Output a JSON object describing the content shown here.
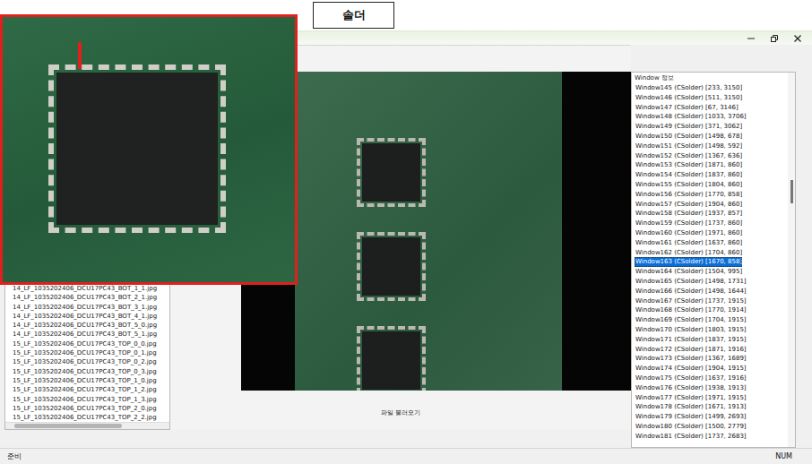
{
  "header_label": "솔더",
  "file_list": {
    "items": [
      "14_LF_1035202406_DCU17PC43_BOT_1_1.jpg",
      "14_LF_1035202406_DCU17PC43_BOT_2_1.jpg",
      "14_LF_1035202406_DCU17PC43_BOT_3_1.jpg",
      "14_LF_1035202406_DCU17PC43_BOT_4_1.jpg",
      "14_LF_1035202406_DCU17PC43_BOT_5_0.jpg",
      "14_LF_1035202406_DCU17PC43_BOT_5_1.jpg",
      "15_LF_1035202406_DCU17PC43_TOP_0_0.jpg",
      "15_LF_1035202406_DCU17PC43_TOP_0_1.jpg",
      "15_LF_1035202406_DCU17PC43_TOP_0_2.jpg",
      "15_LF_1035202406_DCU17PC43_TOP_0_3.jpg",
      "15_LF_1035202406_DCU17PC43_TOP_1_0.jpg",
      "15_LF_1035202406_DCU17PC43_TOP_1_2.jpg",
      "15_LF_1035202406_DCU17PC43_TOP_1_3.jpg",
      "15_LF_1035202406_DCU17PC43_TOP_2_0.jpg",
      "15_LF_1035202406_DCU17PC43_TOP_2_2.jpg"
    ]
  },
  "viewer": {
    "load_button": "파일 불러오기"
  },
  "window_info": {
    "title": "Window 정보",
    "items": [
      {
        "label": "Window145 (CSolder) [233, 3150]",
        "selected": false
      },
      {
        "label": "Window146 (CSolder) [511, 3150]",
        "selected": false
      },
      {
        "label": "Window147 (CSolder) [67, 3146]",
        "selected": false
      },
      {
        "label": "Window148 (CSolder) [1033, 3706]",
        "selected": false
      },
      {
        "label": "Window149 (CSolder) [371, 3062]",
        "selected": false
      },
      {
        "label": "Window150 (CSolder) [1498, 678]",
        "selected": false
      },
      {
        "label": "Window151 (CSolder) [1498, 592]",
        "selected": false
      },
      {
        "label": "Window152 (CSolder) [1367, 636]",
        "selected": false
      },
      {
        "label": "Window153 (CSolder) [1871, 860]",
        "selected": false
      },
      {
        "label": "Window154 (CSolder) [1837, 860]",
        "selected": false
      },
      {
        "label": "Window155 (CSolder) [1804, 860]",
        "selected": false
      },
      {
        "label": "Window156 (CSolder) [1770, 858]",
        "selected": false
      },
      {
        "label": "Window157 (CSolder) [1904, 860]",
        "selected": false
      },
      {
        "label": "Window158 (CSolder) [1937, 857]",
        "selected": false
      },
      {
        "label": "Window159 (CSolder) [1737, 860]",
        "selected": false
      },
      {
        "label": "Window160 (CSolder) [1971, 860]",
        "selected": false
      },
      {
        "label": "Window161 (CSolder) [1637, 860]",
        "selected": false
      },
      {
        "label": "Window162 (CSolder) [1704, 860]",
        "selected": false
      },
      {
        "label": "Window163 (CSolder) [1670, 858]",
        "selected": true
      },
      {
        "label": "Window164 (CSolder) [1504, 995]",
        "selected": false
      },
      {
        "label": "Window165 (CSolder) [1498, 1731]",
        "selected": false
      },
      {
        "label": "Window166 (CSolder) [1498, 1644]",
        "selected": false
      },
      {
        "label": "Window167 (CSolder) [1737, 1915]",
        "selected": false
      },
      {
        "label": "Window168 (CSolder) [1770, 1914]",
        "selected": false
      },
      {
        "label": "Window169 (CSolder) [1704, 1915]",
        "selected": false
      },
      {
        "label": "Window170 (CSolder) [1803, 1915]",
        "selected": false
      },
      {
        "label": "Window171 (CSolder) [1837, 1915]",
        "selected": false
      },
      {
        "label": "Window172 (CSolder) [1871, 1916]",
        "selected": false
      },
      {
        "label": "Window173 (CSolder) [1367, 1689]",
        "selected": false
      },
      {
        "label": "Window174 (CSolder) [1904, 1915]",
        "selected": false
      },
      {
        "label": "Window175 (CSolder) [1637, 1916]",
        "selected": false
      },
      {
        "label": "Window176 (CSolder) [1938, 1913]",
        "selected": false
      },
      {
        "label": "Window177 (CSolder) [1971, 1915]",
        "selected": false
      },
      {
        "label": "Window178 (CSolder) [1671, 1913]",
        "selected": false
      },
      {
        "label": "Window179 (CSolder) [1499, 2693]",
        "selected": false
      },
      {
        "label": "Window180 (CSolder) [1500, 2779]",
        "selected": false
      },
      {
        "label": "Window181 (CSolder) [1737, 2683]",
        "selected": false
      }
    ]
  },
  "status_bar": {
    "left": "준비",
    "right": "NUM"
  }
}
